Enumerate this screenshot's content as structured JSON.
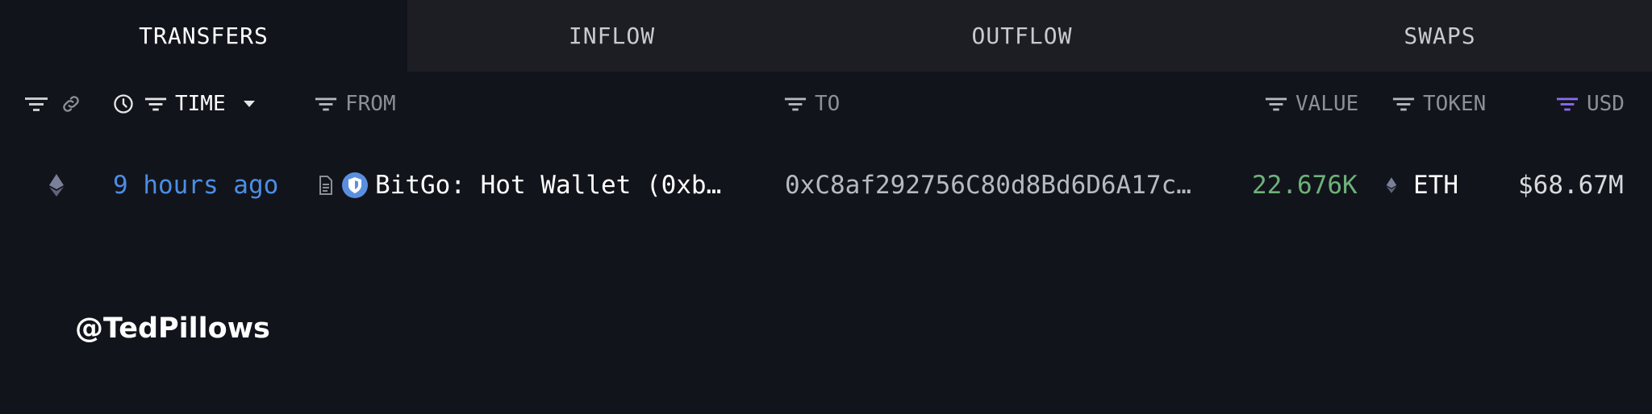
{
  "tabs": [
    {
      "label": "TRANSFERS",
      "active": true
    },
    {
      "label": "INFLOW",
      "active": false
    },
    {
      "label": "OUTFLOW",
      "active": false
    },
    {
      "label": "SWAPS",
      "active": false
    }
  ],
  "columns": {
    "time": "TIME",
    "from": "FROM",
    "to": "TO",
    "value": "VALUE",
    "token": "TOKEN",
    "usd": "USD"
  },
  "rows": [
    {
      "chain_icon": "ethereum-icon",
      "time": "9 hours ago",
      "from": "BitGo: Hot Wallet (0xb…",
      "to": "0xC8af292756C80d8Bd6D6A17c…",
      "value": "22.676K",
      "token": "ETH",
      "usd": "$68.67M"
    }
  ],
  "watermark": "@TedPillows",
  "colors": {
    "background": "#12141b",
    "tab_bar": "#1c1e24",
    "time_link": "#4b8ee6",
    "value_green": "#6db27a",
    "usd_filter_active": "#8b6cf0",
    "entity_badge": "#5a8fe0"
  }
}
